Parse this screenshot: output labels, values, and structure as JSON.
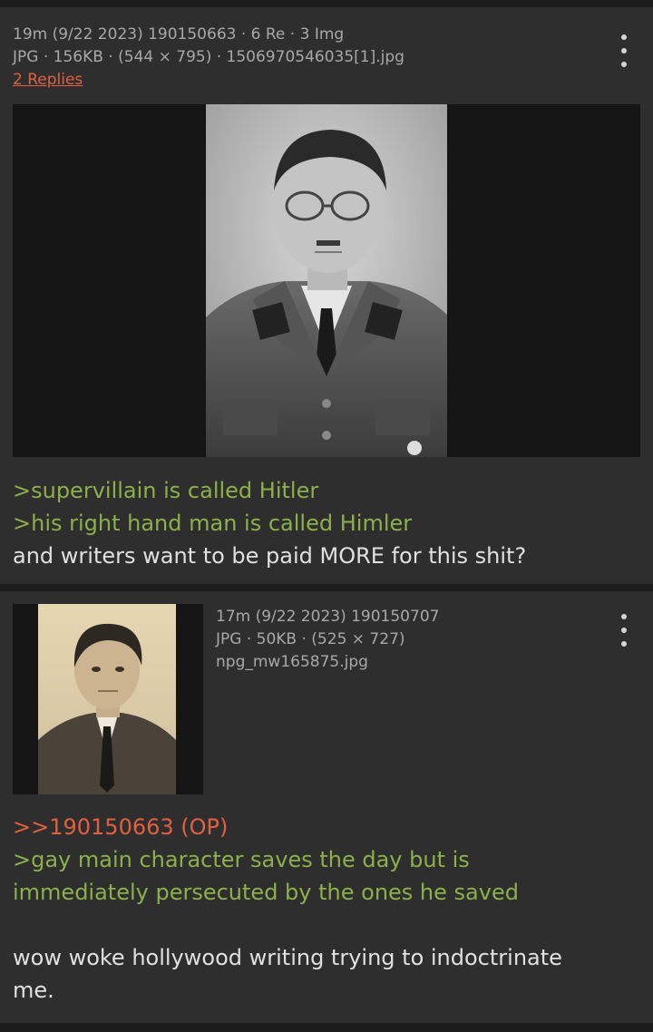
{
  "posts": [
    {
      "meta_line1": "19m (9/22 2023) 190150663 · 6 Re · 3 Img",
      "meta_line2": "JPG · 156KB · (544 × 795) · 1506970546035[1].jpg",
      "replies_link": "2 Replies",
      "menu_icon": "kebab-menu-icon",
      "image": "portrait photo of a man in uniform wearing glasses",
      "lines": [
        ">supervillain is called Hitler",
        ">his right hand man is called Himler",
        "and writers want to be paid MORE for this shit?"
      ]
    },
    {
      "meta_line1": "17m (9/22 2023) 190150707",
      "meta_line2": "JPG · 50KB · (525 × 727)",
      "meta_line3": "npg_mw165875.jpg",
      "menu_icon": "kebab-menu-icon",
      "image": "sepia portrait photo of a man in a suit",
      "quote_link": ">>190150663 (OP)",
      "lines": [
        ">gay main character saves the day but is",
        "immediately persecuted by the ones he saved",
        "wow woke hollywood writing trying to indoctrinate",
        "me."
      ]
    }
  ],
  "colors": {
    "background": "#1c1c1c",
    "post_bg": "#2e2e2e",
    "greentext": "#8cb04a",
    "quotelink": "#e2603f",
    "meta": "#a8a8a8"
  }
}
